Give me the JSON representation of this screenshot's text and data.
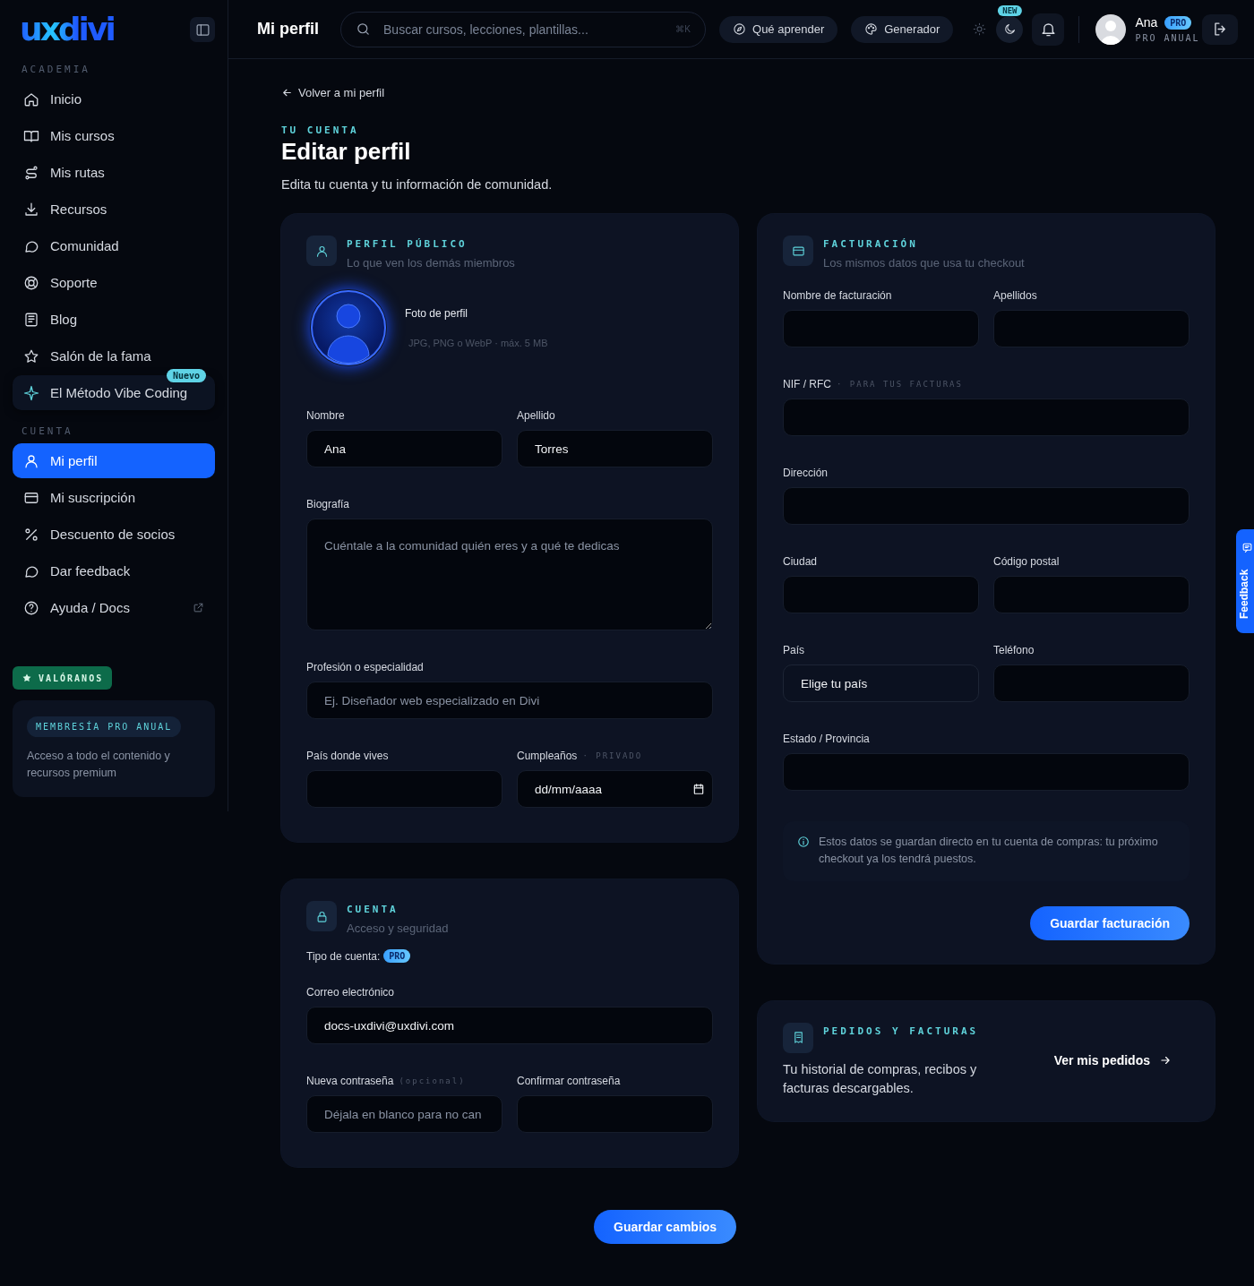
{
  "sidebar": {
    "logo": "uxdivi",
    "sections": [
      {
        "title": "ACADEMIA",
        "items": [
          {
            "label": "Inicio",
            "kind": "link",
            "selected": false
          },
          {
            "label": "Mis cursos",
            "kind": "link",
            "selected": false
          },
          {
            "label": "Mis rutas",
            "kind": "link",
            "selected": false
          },
          {
            "label": "Recursos",
            "kind": "link",
            "selected": false
          },
          {
            "label": "Comunidad",
            "kind": "link",
            "selected": false
          },
          {
            "label": "Soporte",
            "kind": "link",
            "selected": false
          },
          {
            "label": "Blog",
            "kind": "link",
            "selected": false
          },
          {
            "label": "Salón de la fama",
            "kind": "link",
            "selected": false
          },
          {
            "label": "El Método Vibe Coding",
            "kind": "featured",
            "badge": "Nuevo",
            "selected": false
          }
        ]
      },
      {
        "title": "CUENTA",
        "items": [
          {
            "label": "Mi perfil",
            "kind": "link",
            "selected": true
          },
          {
            "label": "Mi suscripción",
            "kind": "link",
            "selected": false
          },
          {
            "label": "Descuento de socios",
            "kind": "link",
            "selected": false
          },
          {
            "label": "Dar feedback",
            "kind": "link",
            "selected": false
          },
          {
            "label": "Ayuda / Docs",
            "kind": "external",
            "selected": false
          }
        ]
      }
    ],
    "rate_button": "VALÓRANOS",
    "membership": {
      "badge": "MEMBRESÍA PRO ANUAL",
      "text": "Acceso a todo el contenido y recursos premium"
    }
  },
  "topbar": {
    "title": "Mi perfil",
    "search": {
      "placeholder": "Buscar cursos, lecciones, plantillas...",
      "shortcut": "⌘K"
    },
    "buttons": [
      "Qué aprender",
      "Generador"
    ],
    "theme_options": [
      {
        "kind": "light",
        "selected": false
      },
      {
        "kind": "dark",
        "selected": true,
        "badge": "NEW"
      }
    ],
    "user": {
      "name": "Ana",
      "badge": "PRO",
      "plan": "PRO ANUAL"
    }
  },
  "page": {
    "back_link": "Volver a mi perfil",
    "eyebrow": "TU CUENTA",
    "title": "Editar perfil",
    "subtitle": "Edita tu cuenta y tu información de comunidad."
  },
  "profile_card": {
    "eyebrow": "PERFIL PÚBLICO",
    "subtitle": "Lo que ven los demás miembros",
    "photo_label": "Foto de perfil",
    "photo_hint": "JPG, PNG o WebP · máx. 5 MB",
    "rows": [
      [
        {
          "label": "Nombre",
          "kind": "text",
          "value": "Ana"
        },
        {
          "label": "Apellido",
          "kind": "text",
          "value": "Torres"
        }
      ],
      [
        {
          "label": "Biografía",
          "kind": "textarea",
          "placeholder": "Cuéntale a la comunidad quién eres y a qué te dedicas"
        }
      ],
      [
        {
          "label": "Profesión o especialidad",
          "kind": "text",
          "placeholder": "Ej. Diseñador web especializado en Divi"
        }
      ],
      [
        {
          "label": "País donde vives",
          "kind": "text"
        },
        {
          "label": "Cumpleaños",
          "note": "· PRIVADO",
          "kind": "date",
          "value": "dd/mm/aaaa"
        }
      ]
    ]
  },
  "account_card": {
    "eyebrow": "CUENTA",
    "subtitle": "Acceso y seguridad",
    "type_label": "Tipo de cuenta:",
    "type_badge": "PRO",
    "rows": [
      [
        {
          "label": "Correo electrónico",
          "kind": "text",
          "value": "docs-uxdivi@uxdivi.com"
        }
      ],
      [
        {
          "label": "Nueva contraseña",
          "note": "(opcional)",
          "kind": "text",
          "placeholder": "Déjala en blanco para no can"
        },
        {
          "label": "Confirmar contraseña",
          "kind": "text"
        }
      ]
    ]
  },
  "billing_card": {
    "eyebrow": "FACTURACIÓN",
    "subtitle": "Los mismos datos que usa tu checkout",
    "rows": [
      [
        {
          "label": "Nombre de facturación",
          "kind": "text"
        },
        {
          "label": "Apellidos",
          "kind": "text"
        }
      ],
      [
        {
          "label": "NIF / RFC",
          "note": "· PARA TUS FACTURAS",
          "kind": "text"
        }
      ],
      [
        {
          "label": "Dirección",
          "kind": "text"
        }
      ],
      [
        {
          "label": "Ciudad",
          "kind": "text"
        },
        {
          "label": "Código postal",
          "kind": "text"
        }
      ],
      [
        {
          "label": "País",
          "kind": "select",
          "value": "Elige tu país"
        },
        {
          "label": "Teléfono",
          "kind": "text"
        }
      ],
      [
        {
          "label": "Estado / Provincia",
          "kind": "text"
        }
      ]
    ],
    "info": "Estos datos se guardan directo en tu cuenta de compras: tu próximo checkout ya los tendrá puestos.",
    "button": "Guardar facturación"
  },
  "orders_card": {
    "eyebrow": "PEDIDOS Y FACTURAS",
    "text": "Tu historial de compras, recibos y facturas descargables.",
    "link": "Ver mis pedidos"
  },
  "save_button": "Guardar cambios",
  "feedback_tab": "Feedback"
}
